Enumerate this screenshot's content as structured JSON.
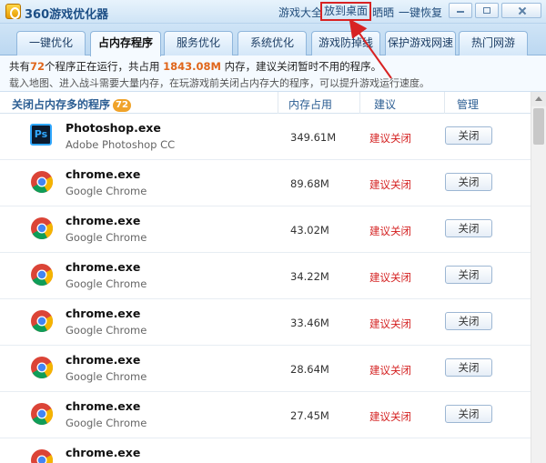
{
  "app": {
    "title": "360游戏优化器",
    "icon": "game-optimizer-logo-icon"
  },
  "top_links": [
    {
      "label": "游戏大全",
      "highlighted": false
    },
    {
      "label": "放到桌面",
      "highlighted": true
    },
    {
      "label": "晒晒",
      "highlighted": false
    },
    {
      "label": "一键恢复",
      "highlighted": false
    }
  ],
  "window_controls": [
    "minimize-icon",
    "maximize-icon",
    "close-icon"
  ],
  "tabs": [
    {
      "label": "一键优化",
      "active": false
    },
    {
      "label": "占内存程序",
      "active": true
    },
    {
      "label": "服务优化",
      "active": false
    },
    {
      "label": "系统优化",
      "active": false
    },
    {
      "label": "游戏防掉线",
      "active": false
    },
    {
      "label": "保护游戏网速",
      "active": false
    },
    {
      "label": "热门网游",
      "active": false
    }
  ],
  "info": {
    "prefix": "共有",
    "process_count": "72",
    "middle": "个程序正在运行，共占用",
    "memory_total": "1843.08M",
    "suffix": "内存，建议关闭暂时不用的程序。",
    "tip": "载入地图、进入战斗需要大量内存，在玩游戏前关闭占内存大的程序，可以提升游戏运行速度。"
  },
  "table": {
    "header_main": "关闭占内存多的程序",
    "header_badge": "72",
    "col_memory": "内存占用",
    "col_advice": "建议",
    "col_manage": "管理"
  },
  "rows": [
    {
      "name": "Photoshop.exe",
      "desc": "Adobe Photoshop CC",
      "memory": "349.61M",
      "advice": "建议关闭",
      "action": "关闭",
      "icon": "photoshop-icon"
    },
    {
      "name": "chrome.exe",
      "desc": "Google Chrome",
      "memory": "89.68M",
      "advice": "建议关闭",
      "action": "关闭",
      "icon": "chrome-icon"
    },
    {
      "name": "chrome.exe",
      "desc": "Google Chrome",
      "memory": "43.02M",
      "advice": "建议关闭",
      "action": "关闭",
      "icon": "chrome-icon"
    },
    {
      "name": "chrome.exe",
      "desc": "Google Chrome",
      "memory": "34.22M",
      "advice": "建议关闭",
      "action": "关闭",
      "icon": "chrome-icon"
    },
    {
      "name": "chrome.exe",
      "desc": "Google Chrome",
      "memory": "33.46M",
      "advice": "建议关闭",
      "action": "关闭",
      "icon": "chrome-icon"
    },
    {
      "name": "chrome.exe",
      "desc": "Google Chrome",
      "memory": "28.64M",
      "advice": "建议关闭",
      "action": "关闭",
      "icon": "chrome-icon"
    },
    {
      "name": "chrome.exe",
      "desc": "Google Chrome",
      "memory": "27.45M",
      "advice": "建议关闭",
      "action": "关闭",
      "icon": "chrome-icon"
    },
    {
      "name": "chrome.exe",
      "desc": "",
      "memory": "",
      "advice": "",
      "action": "",
      "icon": "chrome-icon"
    }
  ],
  "colors": {
    "accent_number": "#e0661b",
    "advice_red": "#d42020",
    "annotation_red": "#d82323",
    "title_blue": "#1d4f86"
  }
}
